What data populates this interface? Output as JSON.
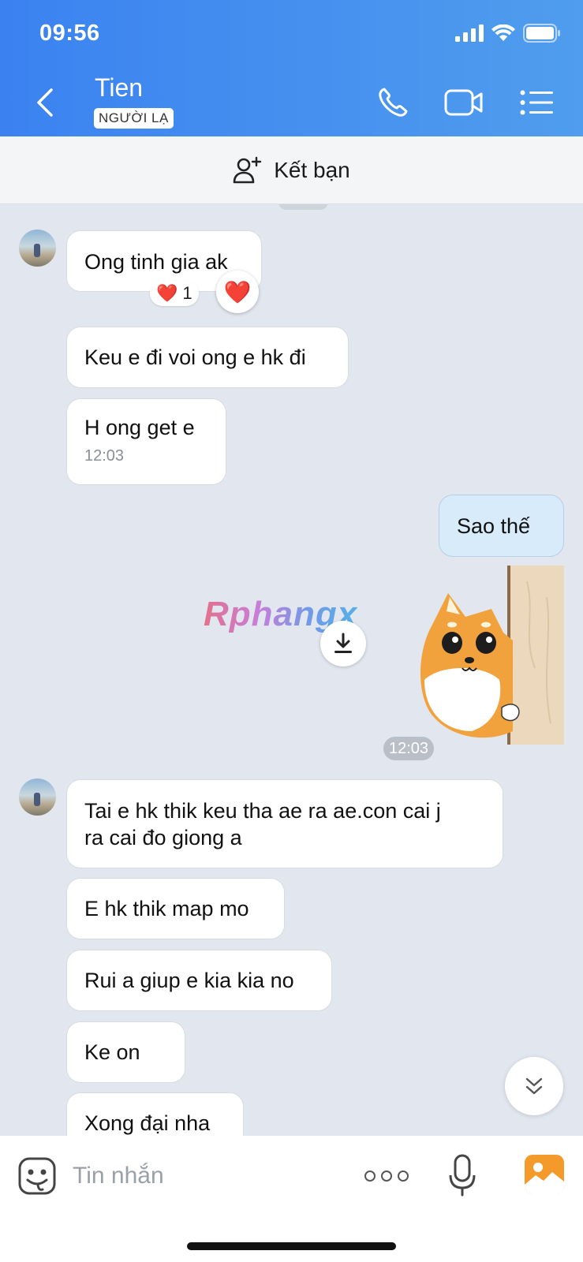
{
  "status_bar": {
    "time": "09:56"
  },
  "header": {
    "contact_name": "Tien",
    "badge": "NGƯỜI LẠ",
    "icons": [
      "back-chevron-icon",
      "phone-icon",
      "video-call-icon",
      "menu-list-icon"
    ]
  },
  "add_friend": {
    "label": "Kết bạn",
    "icon": "add-user-icon"
  },
  "messages": [
    {
      "side": "in",
      "lines": [
        "Ong tinh gia ak"
      ],
      "reaction": {
        "emoji": "❤️",
        "count": "1"
      }
    },
    {
      "side": "in",
      "lines": [
        "Keu e đi voi ong e hk đi"
      ]
    },
    {
      "side": "in",
      "lines": [
        "H ong get e"
      ],
      "time": "12:03"
    },
    {
      "side": "out",
      "lines": [
        "Sao thế"
      ]
    },
    {
      "side": "out",
      "type": "sticker",
      "sticker": "shiba-dog-peeking-sticker"
    },
    {
      "side": "center",
      "type": "time",
      "text": "12:03"
    },
    {
      "side": "in",
      "lines": [
        "Tai e hk thik keu tha ae ra ae.con cai j",
        "ra cai đo giong a"
      ]
    },
    {
      "side": "in",
      "lines": [
        "E hk thik map mo"
      ]
    },
    {
      "side": "in",
      "lines": [
        "Rui a giup e kia kia no"
      ]
    },
    {
      "side": "in",
      "lines": [
        "Ke on"
      ]
    },
    {
      "side": "in",
      "lines": [
        "Xong đại nha"
      ]
    }
  ],
  "react_button": {
    "emoji": "❤️"
  },
  "watermark": "Rphangx",
  "input": {
    "placeholder": "Tin nhắn",
    "value": ""
  },
  "colors": {
    "header_start": "#3b82f0",
    "header_end": "#4f9dee",
    "chat_bg": "#e2e6ee",
    "outgoing_bubble": "#d7ebfb",
    "gallery": "#f39a2a"
  }
}
